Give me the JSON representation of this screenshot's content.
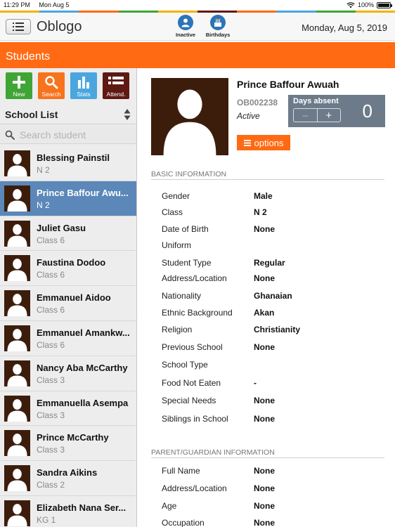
{
  "status_bar": {
    "time": "11:29 PM",
    "date": "Mon Aug 5",
    "battery": "100%"
  },
  "colors": {
    "orange": "#ff6a13",
    "nav_blue": "#2d74b8",
    "selected_row": "#5b87b9",
    "avatar_bg": "#3c1d0c",
    "tool_new": "#3fa535",
    "tool_search": "#f7731c",
    "tool_stats": "#4aa6de",
    "tool_attend": "#5e1a12"
  },
  "app": {
    "title": "Oblogo",
    "date": "Monday, Aug 5, 2019"
  },
  "nav": {
    "inactive": "Inactive",
    "birthdays": "Birthdays"
  },
  "page_title": "Students",
  "tools": {
    "new": "New",
    "search": "Search",
    "stats": "Stats",
    "attend": "Attend."
  },
  "sidebar": {
    "list_title": "School List",
    "search_placeholder": "Search student"
  },
  "students": [
    {
      "name": "Blessing  Painstil",
      "class": "N 2"
    },
    {
      "name": "Prince Baffour Awu...",
      "class": "N 2"
    },
    {
      "name": "Juliet Gasu",
      "class": "Class 6"
    },
    {
      "name": "Faustina Dodoo",
      "class": "Class 6"
    },
    {
      "name": "Emmanuel Aidoo",
      "class": "Class 6"
    },
    {
      "name": "Emmanuel Amankw...",
      "class": "Class 6"
    },
    {
      "name": "Nancy Aba McCarthy",
      "class": "Class 3"
    },
    {
      "name": "Emmanuella Asempa",
      "class": "Class 3"
    },
    {
      "name": "Prince McCarthy",
      "class": "Class 3"
    },
    {
      "name": "Sandra Aikins",
      "class": "Class 2"
    },
    {
      "name": "Elizabeth Nana Ser...",
      "class": "KG 1"
    }
  ],
  "profile": {
    "name": "Prince Baffour Awuah",
    "id": "OB002238",
    "status": "Active",
    "days_absent_label": "Days absent",
    "days_absent": "0",
    "minus": "–",
    "plus": "+",
    "options_label": "options"
  },
  "basic_info": {
    "heading": "BASIC INFORMATION",
    "fields": [
      {
        "k": "Gender",
        "v": "Male"
      },
      {
        "k": "Class",
        "v": "N 2"
      },
      {
        "k": "Date of Birth",
        "v": "None"
      },
      {
        "k": "Uniform",
        "v": ""
      },
      {
        "k": "Student Type",
        "v": "Regular"
      },
      {
        "k": "Address/Location",
        "v": "None"
      },
      {
        "k": "Nationality",
        "v": "Ghanaian"
      },
      {
        "k": "Ethnic Background",
        "v": "Akan"
      },
      {
        "k": "Religion",
        "v": "Christianity"
      },
      {
        "k": "Previous School",
        "v": "None"
      },
      {
        "k": "School Type",
        "v": ""
      },
      {
        "k": "Food Not Eaten",
        "v": "-"
      },
      {
        "k": "Special Needs",
        "v": "None"
      },
      {
        "k": "Siblings in School",
        "v": "None"
      }
    ]
  },
  "parent_info": {
    "heading": "PARENT/GUARDIAN INFORMATION",
    "fields": [
      {
        "k": "Full Name",
        "v": "None"
      },
      {
        "k": "Address/Location",
        "v": "None"
      },
      {
        "k": "Age",
        "v": "None"
      },
      {
        "k": "Occupation",
        "v": "None"
      }
    ]
  }
}
